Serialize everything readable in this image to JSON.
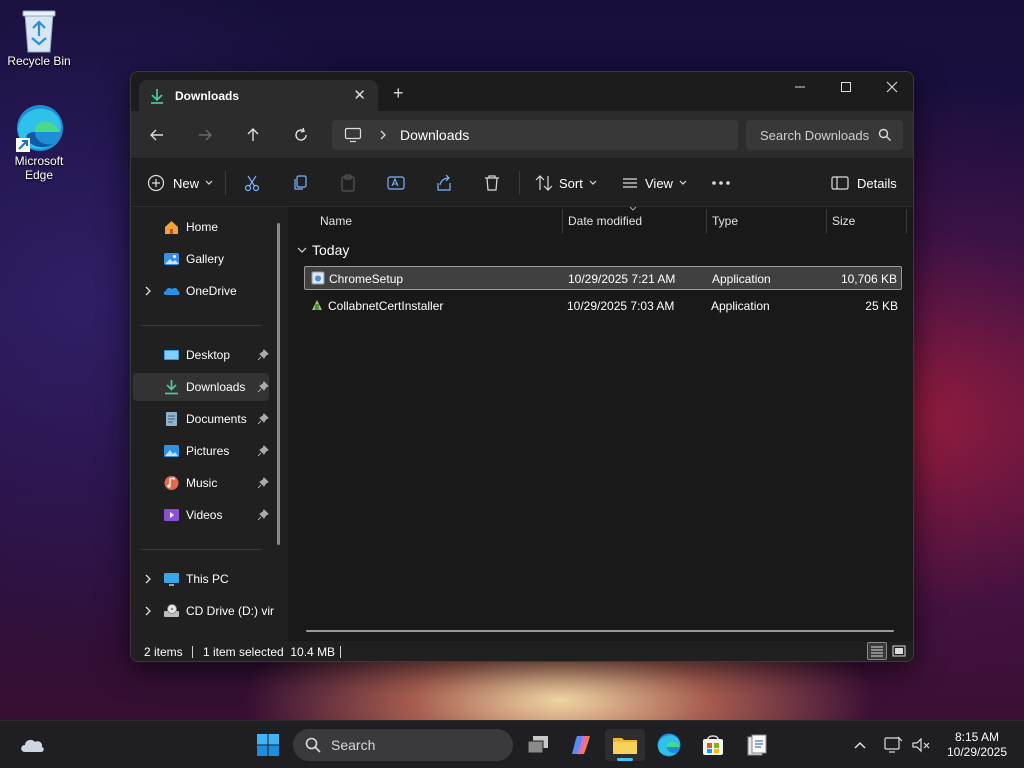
{
  "desktop": {
    "recycle_bin_label": "Recycle Bin",
    "edge_label_line1": "Microsoft",
    "edge_label_line2": "Edge"
  },
  "window": {
    "tab_title": "Downloads",
    "address": "Downloads",
    "search_placeholder": "Search Downloads"
  },
  "command_bar": {
    "new_label": "New",
    "sort_label": "Sort",
    "view_label": "View",
    "details_label": "Details"
  },
  "sidebar": {
    "items": [
      {
        "label": "Home",
        "icon": "home-icon"
      },
      {
        "label": "Gallery",
        "icon": "gallery-icon"
      },
      {
        "label": "OneDrive",
        "icon": "onedrive-icon"
      },
      {
        "label": "Desktop",
        "icon": "desktop-folder-icon",
        "pinned": true
      },
      {
        "label": "Downloads",
        "icon": "downloads-folder-icon",
        "pinned": true,
        "selected": true
      },
      {
        "label": "Documents",
        "icon": "documents-folder-icon",
        "pinned": true
      },
      {
        "label": "Pictures",
        "icon": "pictures-folder-icon",
        "pinned": true
      },
      {
        "label": "Music",
        "icon": "music-folder-icon",
        "pinned": true
      },
      {
        "label": "Videos",
        "icon": "videos-folder-icon",
        "pinned": true
      },
      {
        "label": "This PC",
        "icon": "this-pc-icon"
      },
      {
        "label": "CD Drive (D:) vir",
        "icon": "cd-drive-icon"
      }
    ]
  },
  "file_list": {
    "columns": [
      "Name",
      "Date modified",
      "Type",
      "Size"
    ],
    "group_label": "Today",
    "rows": [
      {
        "name": "ChromeSetup",
        "date": "10/29/2025 7:21 AM",
        "type": "Application",
        "size": "10,706 KB",
        "selected": true
      },
      {
        "name": "CollabnetCertInstaller",
        "date": "10/29/2025 7:03 AM",
        "type": "Application",
        "size": "25 KB",
        "selected": false
      }
    ]
  },
  "status_bar": {
    "item_count": "2 items",
    "selection": "1 item selected  10.4 MB"
  },
  "taskbar": {
    "search_label": "Search",
    "time": "8:15 AM",
    "date": "10/29/2025"
  },
  "colors": {
    "accent_green": "#4cc2a0",
    "window_bg": "#202020",
    "content_bg": "#191919"
  }
}
